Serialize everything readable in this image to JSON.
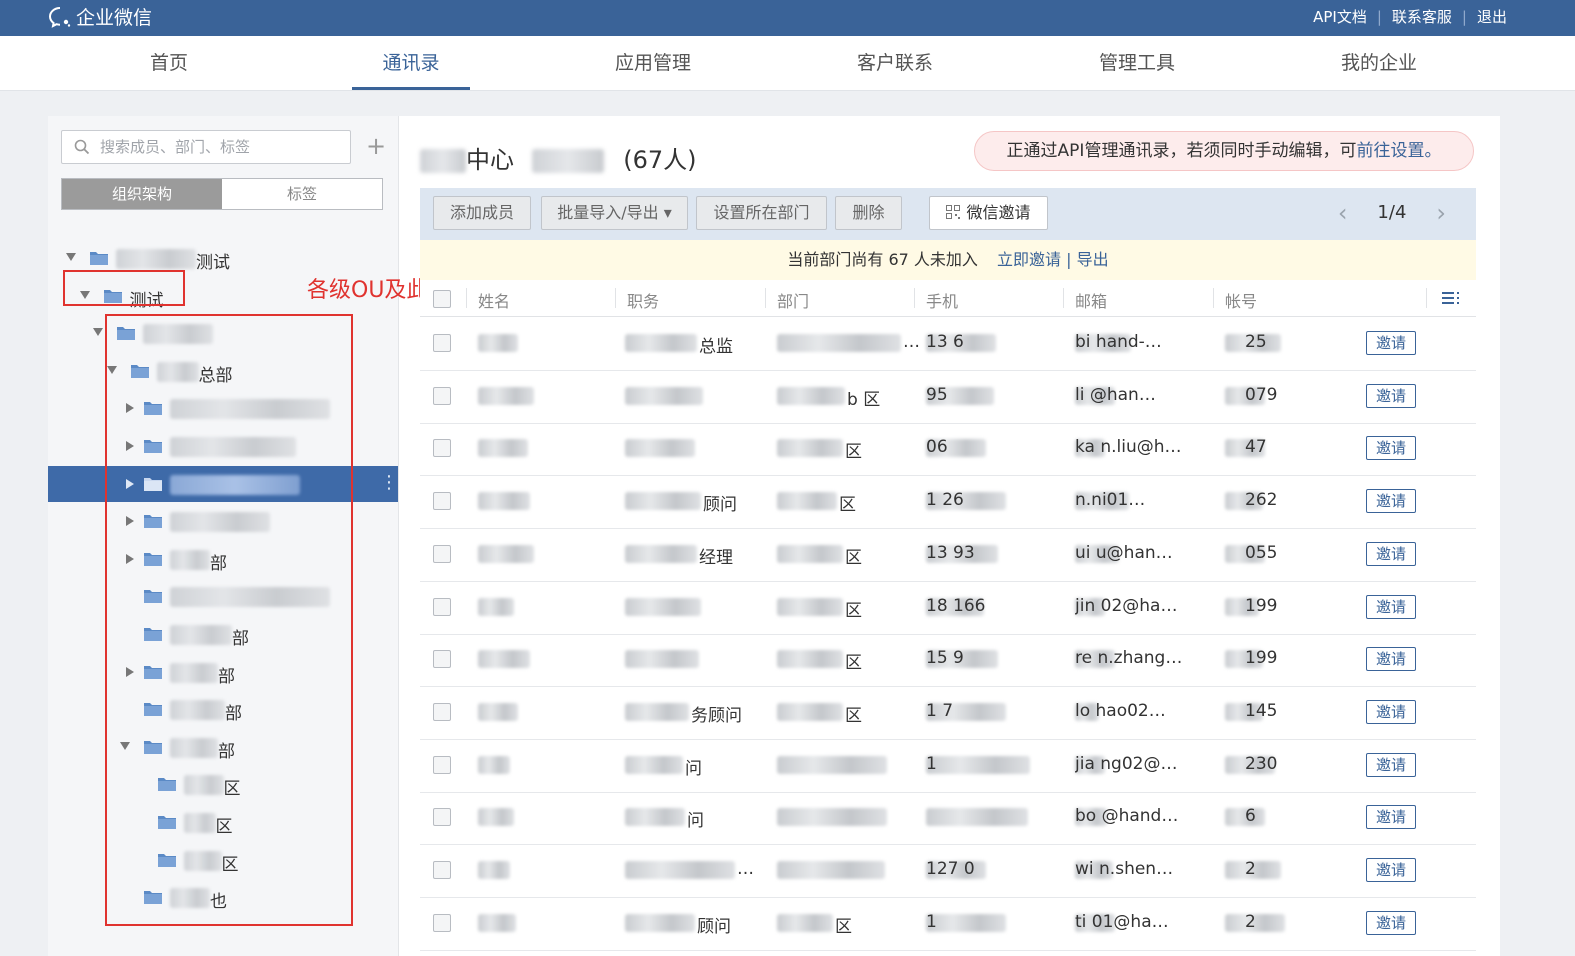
{
  "app": {
    "brand": "企业微信"
  },
  "toplinks": [
    "API文档",
    "联系客服",
    "退出"
  ],
  "nav": [
    {
      "label": "首页"
    },
    {
      "label": "通讯录",
      "active": true
    },
    {
      "label": "应用管理"
    },
    {
      "label": "客户联系"
    },
    {
      "label": "管理工具"
    },
    {
      "label": "我的企业"
    }
  ],
  "sidebar": {
    "search_placeholder": "搜索成员、部门、标签",
    "tabs": [
      "组织架构",
      "标签"
    ],
    "tree": [
      {
        "label": "测试",
        "depth": 0,
        "expand": "open"
      },
      {
        "label": "测试",
        "depth": 1,
        "expand": "open"
      },
      {
        "label": "",
        "depth": 2,
        "expand": "open"
      },
      {
        "label": "总部",
        "depth": 3,
        "expand": "open"
      },
      {
        "label": "",
        "depth": 4,
        "expand": "closed"
      },
      {
        "label": "",
        "depth": 4,
        "expand": "closed"
      },
      {
        "label": "",
        "depth": 4,
        "expand": "closed",
        "selected": true
      },
      {
        "label": "",
        "depth": 4,
        "expand": "closed"
      },
      {
        "label": "部",
        "depth": 4,
        "expand": "closed"
      },
      {
        "label": "",
        "depth": 4,
        "expand": "none"
      },
      {
        "label": "部",
        "depth": 4,
        "expand": "none"
      },
      {
        "label": "部",
        "depth": 4,
        "expand": "closed"
      },
      {
        "label": "部",
        "depth": 4,
        "expand": "none"
      },
      {
        "label": "部",
        "depth": 4,
        "expand": "open"
      },
      {
        "label": "区",
        "depth": 5,
        "expand": "none"
      },
      {
        "label": "区",
        "depth": 5,
        "expand": "none"
      },
      {
        "label": "区",
        "depth": 5,
        "expand": "none"
      },
      {
        "label": "也",
        "depth": 4,
        "expand": "none"
      }
    ]
  },
  "annotation": "各级OU及此OU下对应用户都会同步",
  "dept": {
    "name": "中心",
    "count": "(67人)"
  },
  "api_note": {
    "text": "正通过API管理通讯录，若须同时手动编辑，可",
    "link": "前往设置。"
  },
  "toolbar": {
    "add_member": "添加成员",
    "batch": "批量导入/导出 ▾",
    "set_dept": "设置所在部门",
    "delete": "删除",
    "wechat_invite": "微信邀请",
    "page": "1/4"
  },
  "notice": {
    "text": "当前部门尚有 67 人未加入",
    "invite": "立即邀请",
    "sep": "|",
    "export": "导出"
  },
  "columns": [
    "姓名",
    "职务",
    "部门",
    "手机",
    "邮箱",
    "帐号"
  ],
  "invite_label": "邀请",
  "members": [
    {
      "name": "",
      "title": "总监",
      "dept": "…",
      "phone": "13 6",
      "email": "bi hand-…",
      "account": "25"
    },
    {
      "name": "",
      "title": "",
      "dept": "b 区",
      "phone": "95",
      "email": "li @han…",
      "account": "079"
    },
    {
      "name": "",
      "title": "",
      "dept": "区",
      "phone": "06",
      "email": "ka n.liu@h…",
      "account": "47"
    },
    {
      "name": "",
      "title": "顾问",
      "dept": "区",
      "phone": "1 26",
      "email": "n.ni01…",
      "account": "262"
    },
    {
      "name": "",
      "title": "经理",
      "dept": "区",
      "phone": "13 93",
      "email": "ui u@han…",
      "account": "055"
    },
    {
      "name": "",
      "title": "",
      "dept": "区",
      "phone": "18 166",
      "email": "jin 02@ha…",
      "account": "199"
    },
    {
      "name": "",
      "title": "",
      "dept": "区",
      "phone": "15 9",
      "email": "re n.zhang…",
      "account": "199"
    },
    {
      "name": "",
      "title": "务顾问",
      "dept": "区",
      "phone": "1 7",
      "email": "lo hao02…",
      "account": "145"
    },
    {
      "name": "",
      "title": "问",
      "dept": "",
      "phone": "1",
      "email": "jia ng02@…",
      "account": "230"
    },
    {
      "name": "",
      "title": "问",
      "dept": "",
      "phone": "",
      "email": "bo @hand…",
      "account": "6"
    },
    {
      "name": "",
      "title": "…",
      "dept": "",
      "phone": "127 0",
      "email": "wi n.shen…",
      "account": "2"
    },
    {
      "name": "",
      "title": "顾问",
      "dept": "区",
      "phone": "1",
      "email": "ti 01@ha…",
      "account": "2"
    }
  ]
}
